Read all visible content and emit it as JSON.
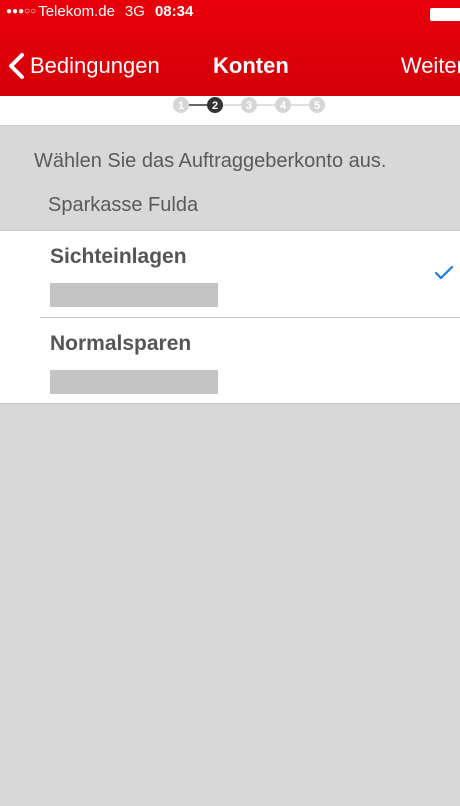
{
  "status_bar": {
    "signal": "●●●○○",
    "carrier": "Telekom.de",
    "network": "3G",
    "time": "08:34"
  },
  "nav": {
    "back_label": "Bedingungen",
    "title": "Konten",
    "next_label": "Weiter"
  },
  "stepper": {
    "steps": [
      "1",
      "2",
      "3",
      "4",
      "5"
    ],
    "current": 2
  },
  "instruction": "Wählen Sie das Auftraggeberkonto aus.",
  "bank_name": "Sparkasse Fulda",
  "accounts": [
    {
      "name": "Sichteinlagen",
      "selected": true
    },
    {
      "name": "Normalsparen",
      "selected": false
    }
  ],
  "colors": {
    "brand_red": "#e60008",
    "check_blue": "#1a7ae6",
    "step_active": "#333333",
    "step_inactive": "#d6d6d6"
  }
}
